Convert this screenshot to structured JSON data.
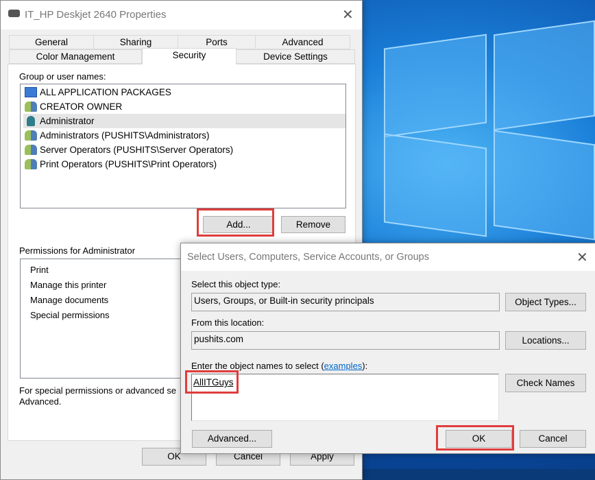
{
  "properties": {
    "title": "IT_HP Deskjet 2640 Properties",
    "icon": "printer-icon",
    "tabs_row1": [
      "General",
      "Sharing",
      "Ports",
      "Advanced"
    ],
    "tabs_row2": [
      "Color Management",
      "Security",
      "Device Settings"
    ],
    "active_tab": "Security",
    "group_label": "Group or user names:",
    "users": [
      {
        "name": "ALL APPLICATION PACKAGES",
        "icon": "app-packages-icon"
      },
      {
        "name": "CREATOR OWNER",
        "icon": "group-icon"
      },
      {
        "name": "Administrator",
        "icon": "user-icon",
        "selected": true
      },
      {
        "name": "Administrators (PUSHITS\\Administrators)",
        "icon": "group-icon"
      },
      {
        "name": "Server Operators (PUSHITS\\Server Operators)",
        "icon": "group-icon"
      },
      {
        "name": "Print Operators (PUSHITS\\Print Operators)",
        "icon": "group-icon"
      }
    ],
    "add_label": "Add...",
    "remove_label": "Remove",
    "permissions_label": "Permissions for Administrator",
    "permissions": [
      "Print",
      "Manage this printer",
      "Manage documents",
      "Special permissions"
    ],
    "footer_line1": "For special permissions or advanced se",
    "footer_line2": "Advanced.",
    "ok_label": "OK",
    "cancel_label": "Cancel",
    "apply_label": "Apply"
  },
  "select_dialog": {
    "title": "Select Users, Computers, Service Accounts, or Groups",
    "object_type_label": "Select this object type:",
    "object_type_value": "Users, Groups, or Built-in security principals",
    "object_types_button": "Object Types...",
    "location_label": "From this location:",
    "location_value": "pushits.com",
    "locations_button": "Locations...",
    "names_label_prefix": "Enter the object names to select (",
    "names_label_link": "examples",
    "names_label_suffix": "):",
    "names_value": "AllITGuys",
    "check_names_button": "Check Names",
    "advanced_button": "Advanced...",
    "ok_button": "OK",
    "cancel_button": "Cancel"
  },
  "colors": {
    "highlight": "#e03c3c",
    "link": "#0066cc"
  }
}
